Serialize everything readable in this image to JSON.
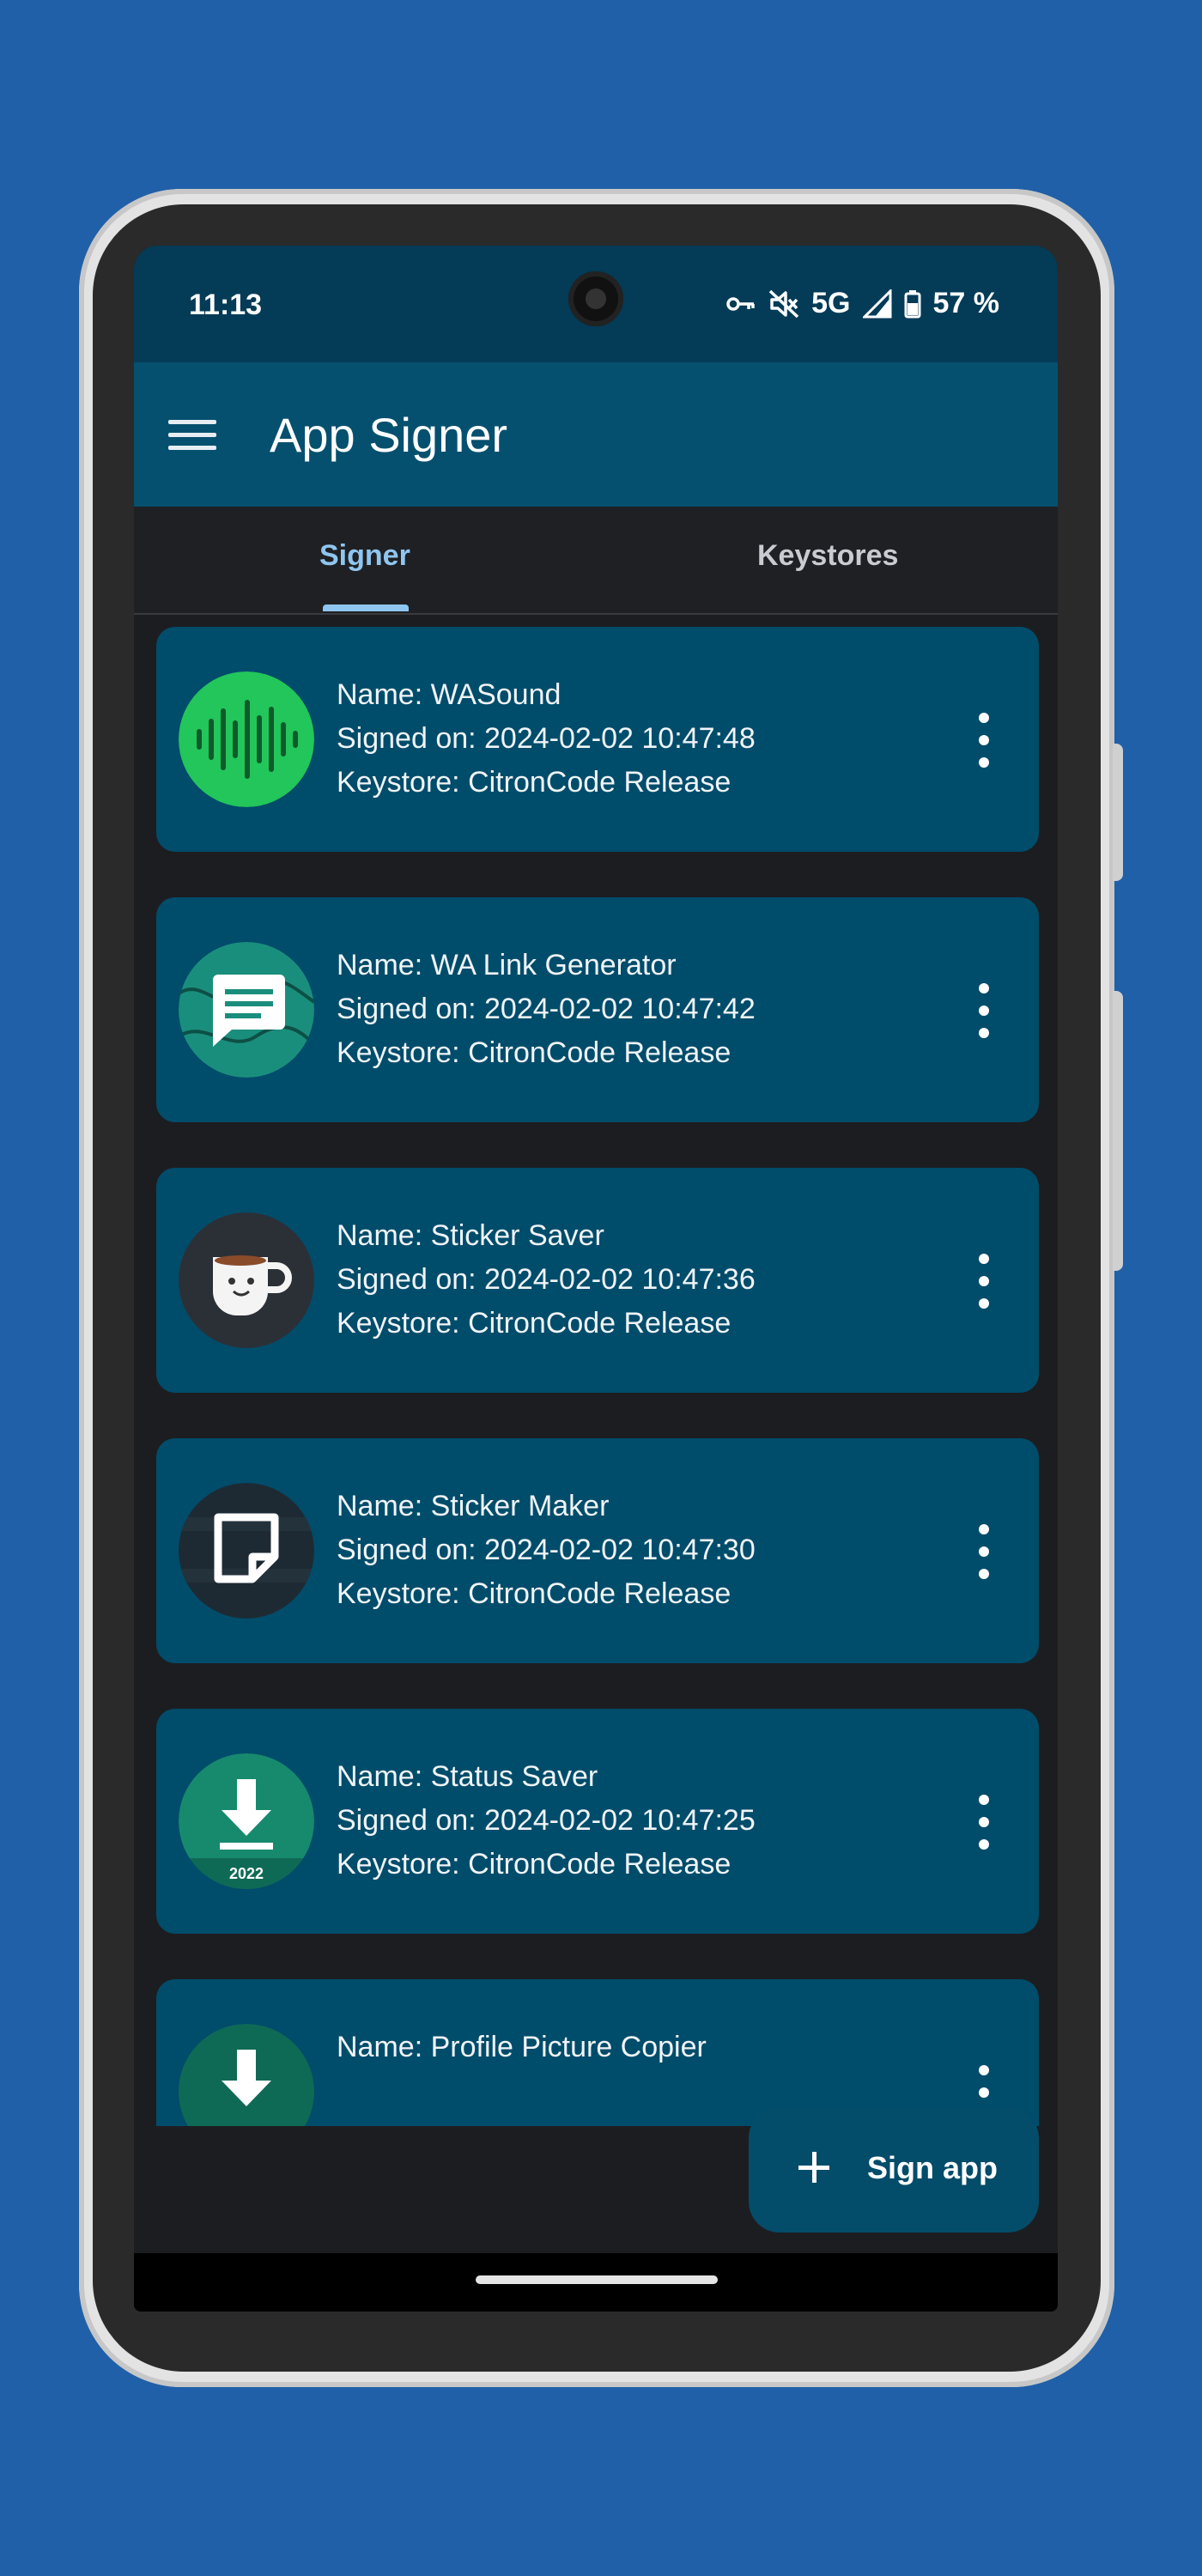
{
  "status_bar": {
    "time": "11:13",
    "network": "5G",
    "battery": "57 %",
    "icons": [
      "vpn-key-icon",
      "mute-icon",
      "signal-icon",
      "battery-icon"
    ]
  },
  "app_bar": {
    "title": "App Signer",
    "menu_icon": "hamburger-menu-icon"
  },
  "tabs": [
    {
      "label": "Signer",
      "selected": true
    },
    {
      "label": "Keystores",
      "selected": false
    }
  ],
  "apps": [
    {
      "name": "Name: WASound",
      "signed": "Signed on: 2024-02-02 10:47:48",
      "keystore": "Keystore: CitronCode Release",
      "icon": "sound-wave-icon"
    },
    {
      "name": "Name: WA Link Generator",
      "signed": "Signed on: 2024-02-02 10:47:42",
      "keystore": "Keystore: CitronCode Release",
      "icon": "chat-bubble-icon"
    },
    {
      "name": "Name: Sticker Saver",
      "signed": "Signed on: 2024-02-02 10:47:36",
      "keystore": "Keystore: CitronCode Release",
      "icon": "coffee-cup-icon"
    },
    {
      "name": "Name: Sticker Maker",
      "signed": "Signed on: 2024-02-02 10:47:30",
      "keystore": "Keystore: CitronCode Release",
      "icon": "sticker-icon"
    },
    {
      "name": "Name: Status Saver",
      "signed": "Signed on: 2024-02-02 10:47:25",
      "keystore": "Keystore: CitronCode Release",
      "icon": "download-icon",
      "icon_text": "2022"
    },
    {
      "name": "Name: Profile Picture Copier",
      "signed": "",
      "keystore": "",
      "icon": "download-icon"
    }
  ],
  "fab": {
    "label": "Sign app",
    "icon": "plus-icon"
  },
  "colors": {
    "background": "#2060a8",
    "app_bar": "#06506f",
    "card": "#004c6b",
    "accent": "#8fc6f0"
  }
}
